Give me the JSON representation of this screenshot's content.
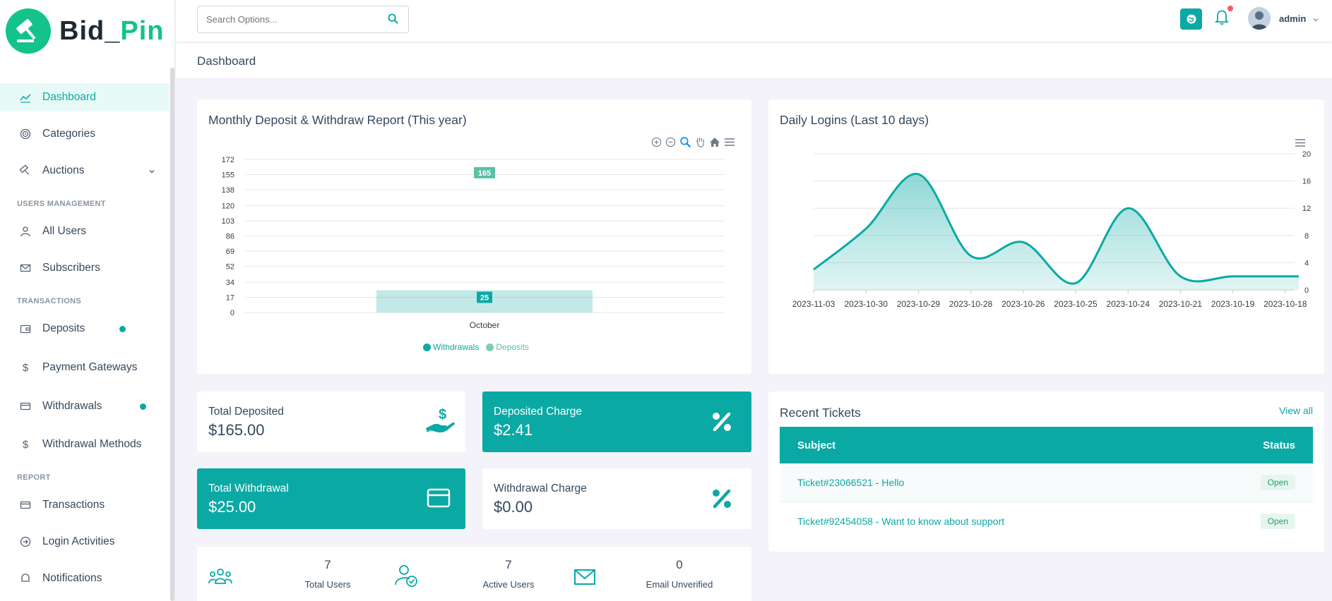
{
  "brand": {
    "part1": "Bid_",
    "part2": "Pin"
  },
  "sidebar": {
    "items": [
      {
        "label": "Dashboard"
      },
      {
        "label": "Categories"
      },
      {
        "label": "Auctions"
      },
      {
        "section": "USERS MANAGEMENT"
      },
      {
        "label": "All Users"
      },
      {
        "label": "Subscribers"
      },
      {
        "section": "TRANSACTIONS"
      },
      {
        "label": "Deposits"
      },
      {
        "label": "Payment Gateways"
      },
      {
        "label": "Withdrawals"
      },
      {
        "label": "Withdrawal Methods"
      },
      {
        "section": "REPORT"
      },
      {
        "label": "Transactions"
      },
      {
        "label": "Login Activities"
      },
      {
        "label": "Notifications"
      }
    ],
    "active": "Dashboard"
  },
  "topbar": {
    "search_placeholder": "Search Options...",
    "user": "admin"
  },
  "page": {
    "title": "Dashboard"
  },
  "deposit_chart": {
    "title": "Monthly Deposit & Withdraw Report (This year)",
    "ticks": [
      "172",
      "155",
      "138",
      "120",
      "103",
      "86",
      "69",
      "52",
      "34",
      "17",
      "0"
    ],
    "category": "October",
    "bar_label_withdraw": "25",
    "bar_label_deposit": "165",
    "legend": {
      "withdrawals": "Withdrawals",
      "deposits": "Deposits"
    }
  },
  "login_chart": {
    "title": "Daily Logins (Last 10 days)",
    "y_ticks": [
      "20",
      "16",
      "12",
      "8",
      "4",
      "0"
    ],
    "dates": [
      "2023-11-03",
      "2023-10-30",
      "2023-10-29",
      "2023-10-28",
      "2023-10-26",
      "2023-10-25",
      "2023-10-24",
      "2023-10-21",
      "2023-10-19",
      "2023-10-18"
    ]
  },
  "chart_data": [
    {
      "type": "bar",
      "title": "Monthly Deposit & Withdraw Report (This year)",
      "categories": [
        "October"
      ],
      "series": [
        {
          "name": "Withdrawals",
          "values": [
            25
          ]
        },
        {
          "name": "Deposits",
          "values": [
            165
          ]
        }
      ],
      "ylim": [
        0,
        172
      ],
      "legend": "bottom",
      "grid": true
    },
    {
      "type": "area",
      "title": "Daily Logins (Last 10 days)",
      "x": [
        "2023-11-03",
        "2023-10-30",
        "2023-10-29",
        "2023-10-28",
        "2023-10-26",
        "2023-10-25",
        "2023-10-24",
        "2023-10-21",
        "2023-10-19",
        "2023-10-18"
      ],
      "values": [
        3,
        9,
        17,
        5,
        7,
        1,
        12,
        2,
        2,
        2
      ],
      "ylim": [
        0,
        20
      ],
      "y_axis_side": "right",
      "grid": true
    }
  ],
  "stats": {
    "total_deposited": {
      "label": "Total Deposited",
      "value": "$165.00"
    },
    "deposited_charge": {
      "label": "Deposited Charge",
      "value": "$2.41"
    },
    "total_withdrawal": {
      "label": "Total Withdrawal",
      "value": "$25.00"
    },
    "withdrawal_charge": {
      "label": "Withdrawal Charge",
      "value": "$0.00"
    }
  },
  "users": {
    "total": {
      "num": "7",
      "label": "Total Users"
    },
    "active": {
      "num": "7",
      "label": "Active Users"
    },
    "email_unverified": {
      "num": "0",
      "label": "Email Unverified"
    }
  },
  "tickets": {
    "title": "Recent Tickets",
    "view_all": "View all",
    "col_subject": "Subject",
    "col_status": "Status",
    "rows": [
      {
        "subject": "Ticket#23066521 - Hello",
        "status": "Open"
      },
      {
        "subject": "Ticket#92454058 - Want to know about support",
        "status": "Open"
      }
    ]
  },
  "colors": {
    "accent": "#0aa9a4",
    "brand_green": "#14c28b",
    "deposit": "#5bc0a5"
  }
}
